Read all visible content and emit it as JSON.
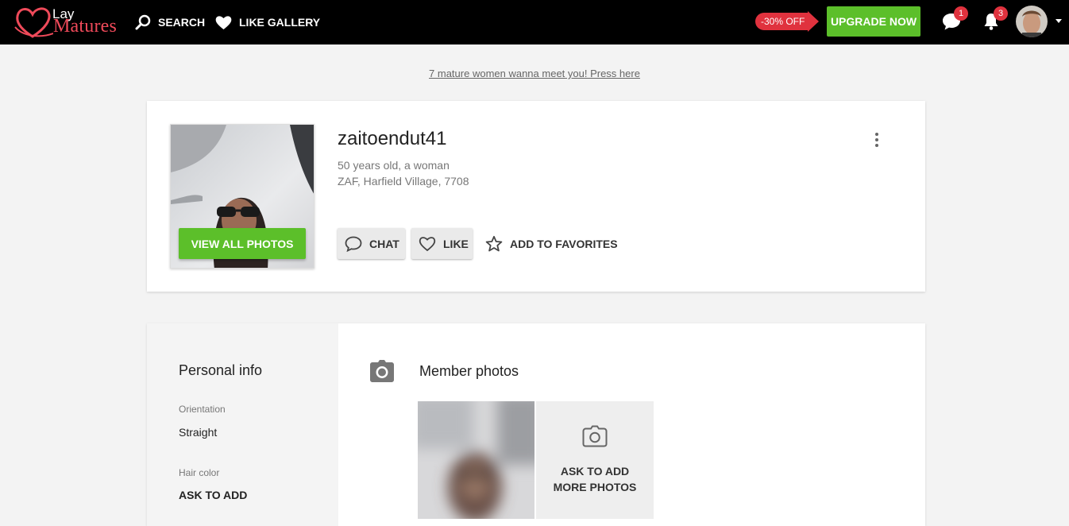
{
  "header": {
    "logo_top": "Lay",
    "logo_bottom": "Matures",
    "nav_search": "SEARCH",
    "nav_like_gallery": "LIKE GALLERY",
    "promo_badge": "-30% OFF",
    "upgrade_label": "UPGRADE NOW",
    "chat_count": "1",
    "notification_count": "3",
    "icons": [
      "heart-logo-icon",
      "search-icon",
      "heart-icon",
      "chat-bubble-icon",
      "bell-icon",
      "caret-down-icon"
    ]
  },
  "promo_link": "7 mature women wanna meet you! Press here",
  "profile": {
    "username": "zaitoendut41",
    "age_gender": "50 years old, a woman",
    "location": "ZAF, Harfield Village, 7708",
    "view_all_photos": "VIEW ALL PHOTOS",
    "actions": {
      "chat": "CHAT",
      "like": "LIKE",
      "favorites": "ADD TO FAVORITES"
    }
  },
  "personal_info": {
    "title": "Personal info",
    "orientation_label": "Orientation",
    "orientation_value": "Straight",
    "hair_color_label": "Hair color",
    "hair_color_value": "ASK TO ADD"
  },
  "member_photos": {
    "title": "Member photos",
    "ask_more": "ASK TO ADD MORE PHOTOS"
  },
  "colors": {
    "accent_green": "#5cbf2a",
    "badge_red": "#e0323e",
    "topbar": "#000000"
  }
}
